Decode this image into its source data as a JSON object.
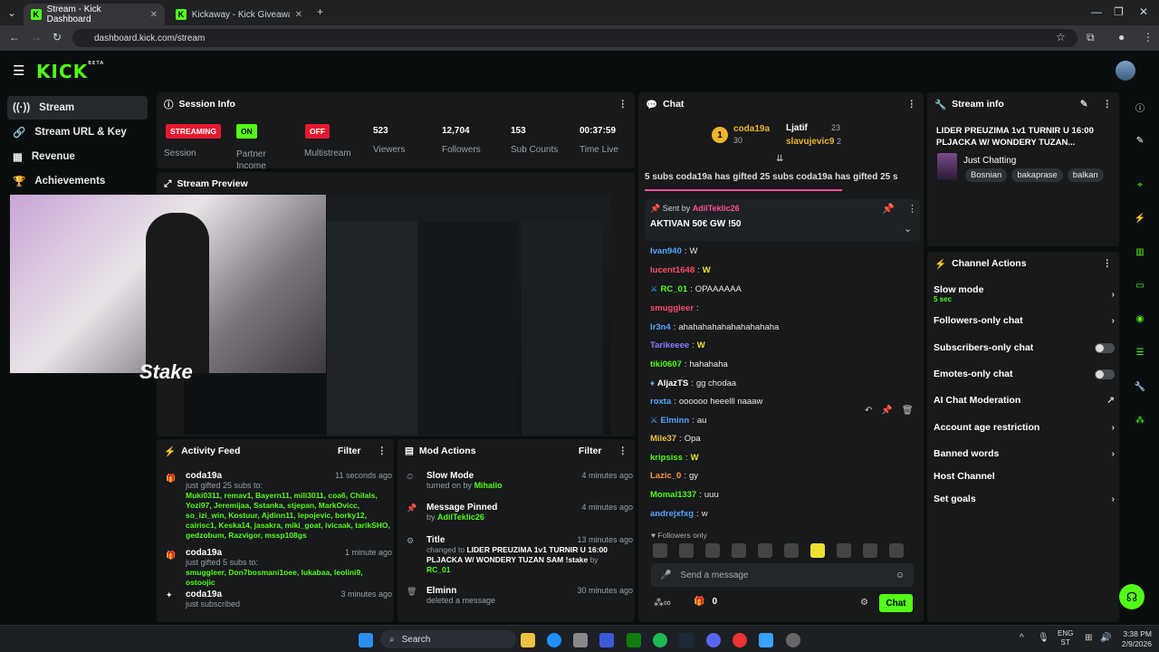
{
  "browser": {
    "tabs": [
      {
        "title": "Stream - Kick Dashboard",
        "active": true
      },
      {
        "title": "Kickaway - Kick Giveaway Tool",
        "active": false
      }
    ],
    "url": "dashboard.kick.com/stream"
  },
  "app": {
    "logo": "KICK",
    "logo_badge": "BETA"
  },
  "sidebar": {
    "items": [
      {
        "label": "Stream",
        "icon": "radio-icon"
      },
      {
        "label": "Stream URL & Key",
        "icon": "link-icon"
      },
      {
        "label": "Revenue",
        "icon": "chart-icon"
      },
      {
        "label": "Achievements",
        "icon": "trophy-icon"
      }
    ]
  },
  "session": {
    "title": "Session Info",
    "streaming_badge": "STREAMING",
    "session_label": "Session",
    "partner_badge": "ON",
    "partner_label": "Partner Income",
    "multistream_badge": "OFF",
    "multistream_label": "Multistream",
    "viewers": "523",
    "viewers_label": "Viewers",
    "followers": "12,704",
    "followers_label": "Followers",
    "subs": "153",
    "subs_label": "Sub Counts",
    "time_live": "00:37:59",
    "time_label": "Time Live"
  },
  "preview": {
    "title": "Stream Preview",
    "overlay_text": "Stake"
  },
  "activity": {
    "title": "Activity Feed",
    "filter": "Filter",
    "items": [
      {
        "name": "coda19a",
        "time": "11 seconds ago",
        "desc": "just gifted 25 subs to:",
        "list": "Muki0311, remav1, Bayern11, mili3011, coa6, Chilals, Yozi97, Jeremijaa, Sstanka, stjepan, MarkOvicc, so_izi_win, Kostuur, Ajdinn11, lepojevic, borky12, cairisc1, Keska14, jasakra, miki_goat, ivicaak, tarikSHO, gedzobum, Razvigor, mssp108gs"
      },
      {
        "name": "coda19a",
        "time": "1 minute ago",
        "desc": "just gifted 5 subs to:",
        "list": "smuggleer, Don7bosmani1oee, lukabaa, leolini9, ostoojic"
      },
      {
        "name": "coda19a",
        "time": "3 minutes ago",
        "desc": "just subscribed",
        "list": ""
      }
    ]
  },
  "mod": {
    "title": "Mod Actions",
    "filter": "Filter",
    "items": [
      {
        "title": "Slow Mode",
        "time": "4 minutes ago",
        "line1": "turned on by",
        "who": "Mihailo"
      },
      {
        "title": "Message Pinned",
        "time": "4 minutes ago",
        "line1": "by",
        "who": "AdilTeklic26"
      },
      {
        "title": "Title",
        "time": "13 minutes ago",
        "line1": "changed to",
        "who": "LIDER PREUZIMA 1v1 TURNIR U 16:00 PLJACKA W/ WONDERY TUZAN SAM !stake",
        "by": "by",
        "whoby": "RC_01"
      },
      {
        "title": "Elminn",
        "time": "30 minutes ago",
        "line1": "deleted a message",
        "who": ""
      }
    ]
  },
  "chat": {
    "title": "Chat",
    "top1_name": "coda19a",
    "top1_count": "30",
    "top2_name": "Ljatif",
    "top2_count": "23",
    "top3_name": "slavujevic9",
    "top3_count": "2",
    "ticker": "5 subs  coda19a has gifted 25 subs  coda19a has gifted 25 s",
    "pinned_by_label": "Sent by",
    "pinned_by": "AdilTeklic26",
    "pinned_text": "AKTIVAN 50€ GW !50",
    "messages": [
      {
        "user": "Ivan940",
        "text": "W",
        "color": "#53a6ff"
      },
      {
        "user": "lucent1648",
        "text": "W",
        "color": "#ff4d6a"
      },
      {
        "user": "RC_01",
        "text": "OPAAAAAA",
        "color": "#53fc18"
      },
      {
        "user": "smuggleer",
        "text": "",
        "color": "#ff4d6a"
      },
      {
        "user": "Ir3n4",
        "text": "ahahahahahahahahahaha",
        "color": "#53a6ff"
      },
      {
        "user": "Tarikeeee",
        "text": "W",
        "color": "#8a7dff"
      },
      {
        "user": "tiki0607",
        "text": "hahahaha",
        "color": "#53fc18"
      },
      {
        "user": "AljazTS",
        "text": "gg chodaa",
        "color": "#fff"
      },
      {
        "user": "roxta",
        "text": "oooooo heeelll naaaw",
        "color": "#53a6ff"
      },
      {
        "user": "Elminn",
        "text": "au",
        "color": "#53a6ff"
      },
      {
        "user": "Mile37",
        "text": "Opa",
        "color": "#f0c040"
      },
      {
        "user": "kripsiss",
        "text": "W",
        "color": "#53fc18"
      },
      {
        "user": "Lazic_0",
        "text": "gy",
        "color": "#ff9a3c"
      },
      {
        "user": "Momal1337",
        "text": "uuu",
        "color": "#53fc18"
      },
      {
        "user": "andrejxfxg",
        "text": "w",
        "color": "#53a6ff"
      }
    ],
    "followers_only": "Followers only",
    "input_placeholder": "Send a message",
    "count": "0",
    "send": "Chat"
  },
  "stream_info": {
    "title": "Stream info",
    "stream_title": "LIDER PREUZIMA 1v1 TURNIR U 16:00 PLJACKA W/ WONDERY TUZAN...",
    "category": "Just Chatting",
    "tags": [
      "Bosnian",
      "bakaprase",
      "balkan"
    ]
  },
  "channel_actions": {
    "title": "Channel Actions",
    "items": [
      {
        "label": "Slow mode",
        "sub": "5 sec",
        "control": "arrow"
      },
      {
        "label": "Followers-only chat",
        "sub": "",
        "control": "arrow"
      },
      {
        "label": "Subscribers-only chat",
        "sub": "",
        "control": "toggle"
      },
      {
        "label": "Emotes-only chat",
        "sub": "",
        "control": "toggle"
      },
      {
        "label": "AI Chat Moderation",
        "sub": "",
        "control": "external"
      },
      {
        "label": "Account age restriction",
        "sub": "",
        "control": "arrow"
      },
      {
        "label": "Banned words",
        "sub": "",
        "control": "arrow"
      },
      {
        "label": "Host Channel",
        "sub": "",
        "control": "none"
      },
      {
        "label": "Set goals",
        "sub": "",
        "control": "arrow"
      }
    ]
  },
  "taskbar": {
    "search": "Search",
    "lang": "ENG",
    "lang2": "ST",
    "time": "3:38 PM",
    "date": "2/9/2026"
  },
  "colors": {
    "accent": "#53fc18",
    "danger": "#e5192f",
    "panel": "#17191b",
    "bg": "#0b0e0f"
  }
}
